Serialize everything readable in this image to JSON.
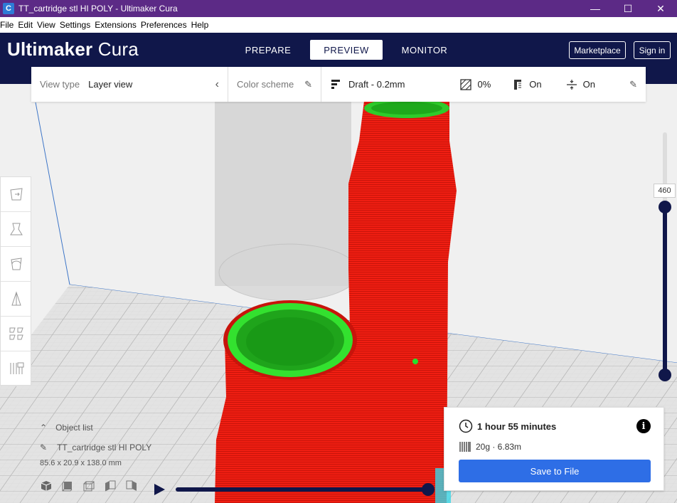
{
  "window": {
    "title": "TT_cartridge stl HI POLY - Ultimaker Cura",
    "app_icon_letter": "C"
  },
  "menu": [
    "File",
    "Edit",
    "View",
    "Settings",
    "Extensions",
    "Preferences",
    "Help"
  ],
  "header": {
    "logo_bold": "Ultimaker",
    "logo_light": "Cura",
    "stages": [
      "PREPARE",
      "PREVIEW",
      "MONITOR"
    ],
    "active_stage": "PREVIEW",
    "marketplace": "Marketplace",
    "signin": "Sign in"
  },
  "toolbar": {
    "view_type_label": "View type",
    "view_type_value": "Layer view",
    "color_scheme_label": "Color scheme",
    "profile": "Draft - 0.2mm",
    "infill": "0%",
    "support": "On",
    "adhesion": "On"
  },
  "layer_slider": {
    "value": "460"
  },
  "object": {
    "list_label": "Object list",
    "name": "TT_cartridge stl HI POLY",
    "dimensions": "85.6 x 20.9 x 138.0 mm"
  },
  "print": {
    "time": "1 hour 55 minutes",
    "material": "20g · 6.83m",
    "save_label": "Save to File"
  },
  "colors": {
    "titlebar": "#5c2a86",
    "header": "#10174a",
    "model_red": "#f01e12",
    "model_green": "#27e12d",
    "accent_blue": "#2e6ee6"
  }
}
